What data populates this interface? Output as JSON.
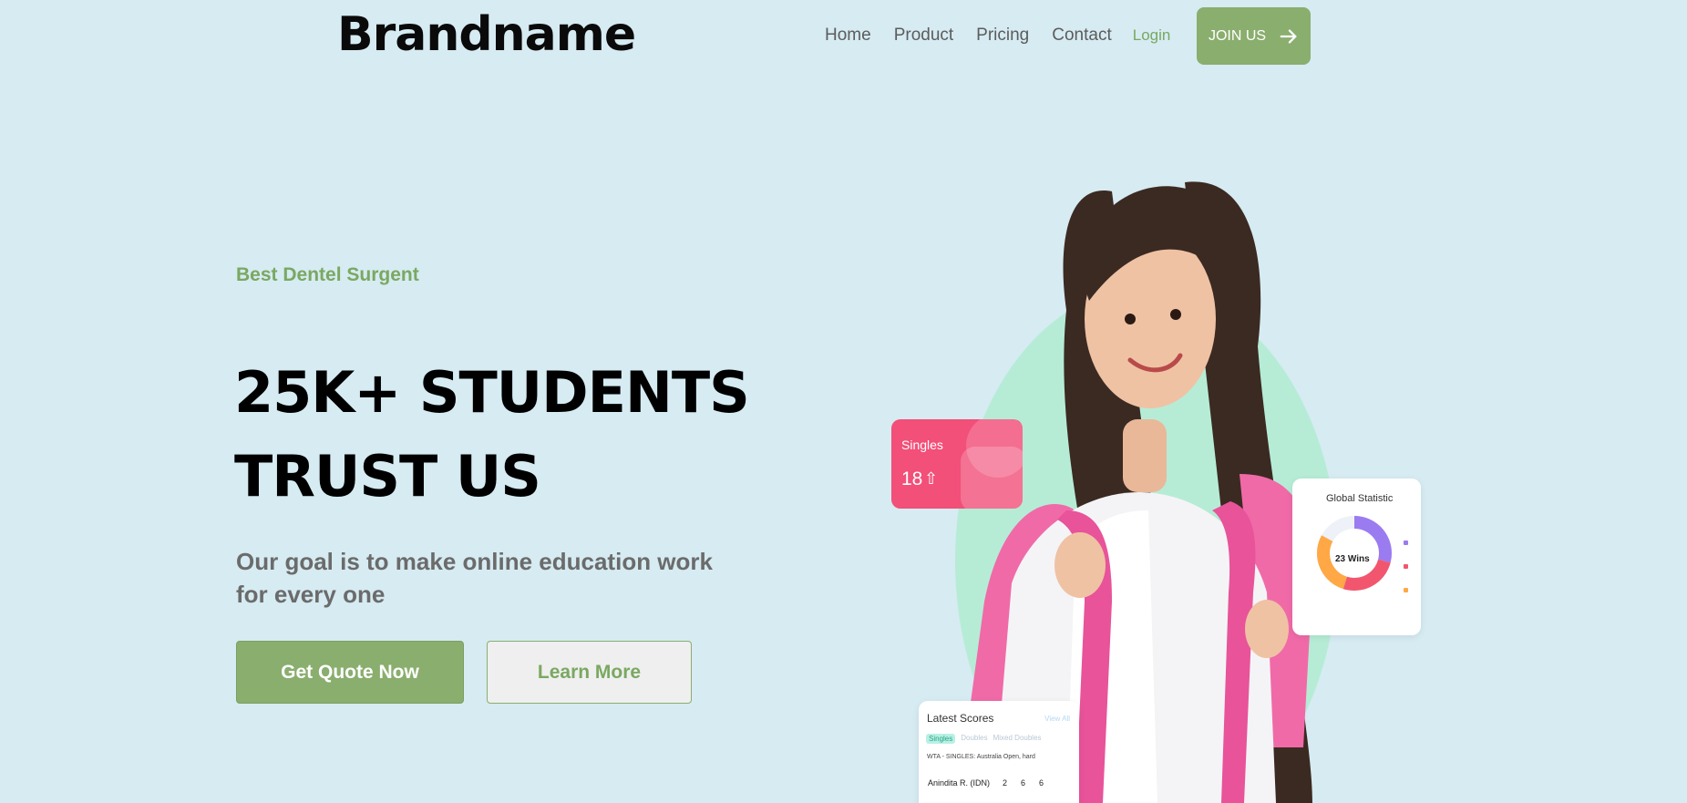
{
  "header": {
    "brand": "Brandname",
    "nav": [
      {
        "label": "Home"
      },
      {
        "label": "Product"
      },
      {
        "label": "Pricing"
      },
      {
        "label": "Contact"
      }
    ],
    "login_label": "Login",
    "join_label": "JOIN US"
  },
  "hero": {
    "kicker": "Best Dentel Surgent",
    "headline_line1": "25K+ STUDENTS",
    "headline_line2": "TRUST US",
    "subtext": "Our goal is to make online education work for every one",
    "primary_button": "Get Quote Now",
    "secondary_button": "Learn More"
  },
  "widgets": {
    "singles": {
      "title": "Singles",
      "value": "18"
    },
    "global": {
      "title": "Global Statistic",
      "center": "23 Wins"
    },
    "scores": {
      "title": "Latest Scores",
      "view_all": "View All",
      "tabs": [
        "Singles",
        "Doubles",
        "Mixed Doubles"
      ],
      "event": "WTA - SINGLES: Australia Open, hard",
      "row": {
        "player": "Anindita R. (IDN)",
        "s1": "2",
        "s2": "6",
        "s3": "6"
      }
    }
  },
  "colors": {
    "background": "#d6ebf2",
    "accent_green": "#8aae6e",
    "text_green": "#7aa861",
    "mint_blob": "#b6ecd6",
    "singles_card": "#f24f79"
  },
  "icons": [
    "arrow-right-icon",
    "arrow-up-icon"
  ]
}
